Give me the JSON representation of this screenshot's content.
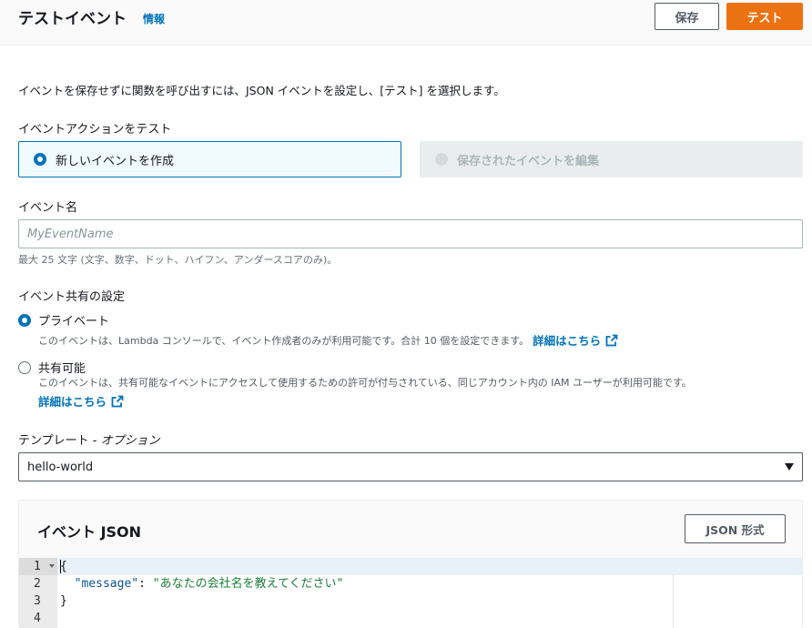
{
  "header": {
    "title": "テストイベント",
    "info_link": "情報",
    "save_label": "保存",
    "test_label": "テスト"
  },
  "description": "イベントを保存せずに関数を呼び出すには、JSON イベントを設定し、[テスト] を選択します。",
  "test_action": {
    "label": "イベントアクションをテスト",
    "options": [
      {
        "label": "新しいイベントを作成",
        "selected": true,
        "disabled": false
      },
      {
        "label": "保存されたイベントを編集",
        "selected": false,
        "disabled": true
      }
    ]
  },
  "event_name": {
    "label": "イベント名",
    "placeholder": "MyEventName",
    "value": "",
    "hint": "最大 25 文字 (文字、数字、ドット、ハイフン、アンダースコアのみ)。"
  },
  "sharing": {
    "label": "イベント共有の設定",
    "private": {
      "label": "プライベート",
      "description": "このイベントは、Lambda コンソールで、イベント作成者のみが利用可能です。合計 10 個を設定できます。",
      "link": "詳細はこちら",
      "selected": true
    },
    "shareable": {
      "label": "共有可能",
      "description": "このイベントは、共有可能なイベントにアクセスして使用するための許可が付与されている、同じアカウント内の IAM ユーザーが利用可能です。",
      "link": "詳細はこちら",
      "selected": false
    }
  },
  "template": {
    "label": "テンプレート - ",
    "label_optional": "オプション",
    "selected": "hello-world"
  },
  "event_json": {
    "title": "イベント JSON",
    "format_button": "JSON 形式",
    "line_numbers": [
      "1",
      "2",
      "3",
      "4"
    ],
    "lines": {
      "l1": "{",
      "l2_key": "\"message\"",
      "l2_sep": ": ",
      "l2_value": "\"あなたの会社名を教えてください\"",
      "l3": "}"
    }
  },
  "colors": {
    "accent_orange": "#ec7211",
    "link_blue": "#0073bb",
    "selected_tile_bg": "#f1faff"
  }
}
